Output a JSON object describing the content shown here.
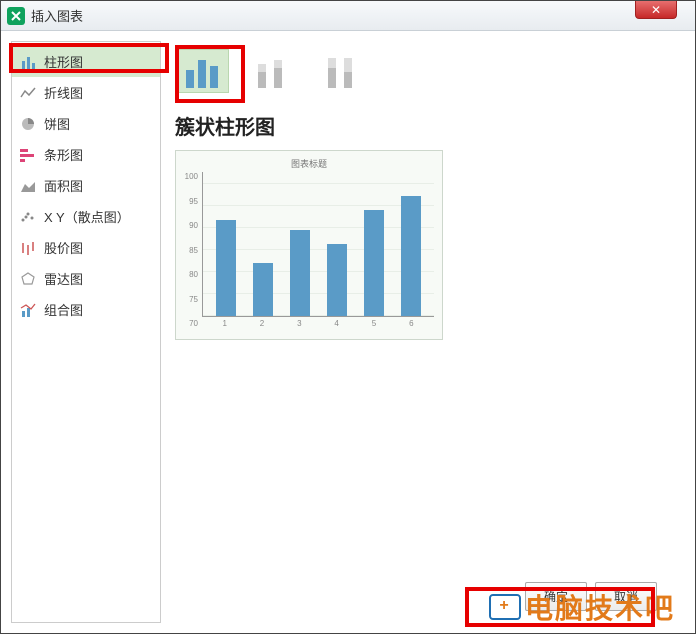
{
  "window": {
    "title": "插入图表",
    "close_icon": "✕"
  },
  "sidebar": {
    "items": [
      {
        "label": "柱形图",
        "icon": "bar-vertical-icon",
        "selected": true
      },
      {
        "label": "折线图",
        "icon": "line-icon",
        "selected": false
      },
      {
        "label": "饼图",
        "icon": "pie-icon",
        "selected": false
      },
      {
        "label": "条形图",
        "icon": "bar-horizontal-icon",
        "selected": false
      },
      {
        "label": "面积图",
        "icon": "area-icon",
        "selected": false
      },
      {
        "label": "X Y（散点图）",
        "icon": "scatter-icon",
        "selected": false
      },
      {
        "label": "股价图",
        "icon": "stock-icon",
        "selected": false
      },
      {
        "label": "雷达图",
        "icon": "radar-icon",
        "selected": false
      },
      {
        "label": "组合图",
        "icon": "combo-icon",
        "selected": false
      }
    ]
  },
  "subtypes": [
    {
      "name": "clustered",
      "selected": true
    },
    {
      "name": "stacked",
      "selected": false
    },
    {
      "name": "stacked100",
      "selected": false
    }
  ],
  "main": {
    "selection_title": "簇状柱形图",
    "preview_title": "图表标题"
  },
  "footer": {
    "ok_label": "确定",
    "cancel_label": "取消"
  },
  "watermark": "电脑技术吧",
  "chart_data": {
    "type": "bar",
    "title": "图表标题",
    "categories": [
      "1",
      "2",
      "3",
      "4",
      "5",
      "6"
    ],
    "values": [
      90,
      81,
      88,
      85,
      92,
      95
    ],
    "ylim": [
      70,
      100
    ],
    "yticks": [
      70,
      75,
      80,
      85,
      90,
      95,
      100
    ],
    "xlabel": "",
    "ylabel": ""
  }
}
